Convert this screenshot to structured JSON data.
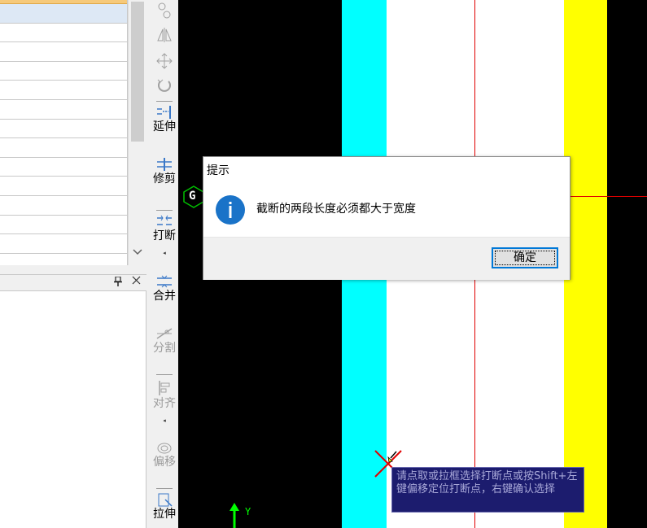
{
  "toolbar": {
    "extend_label": "延伸",
    "trim_label": "修剪",
    "break_label": "打断",
    "merge_label": "合并",
    "split_label": "分割",
    "align_label": "对齐",
    "offset_label": "偏移",
    "stretch_label": "拉伸"
  },
  "canvas": {
    "snap_label": "G",
    "ucs_y_label": "Y",
    "tooltip": "请点取或拉框选择打断点或按Shift+左键偏移定位打断点，右键确认选择"
  },
  "dialog": {
    "title": "提示",
    "message": "截断的两段长度必须都大于宽度",
    "ok_label": "确定"
  },
  "colors": {
    "cyan_band": "#00ffff",
    "yellow_band": "#ffff00",
    "white_band": "#ffffff",
    "red_line": "#e00000",
    "tooltip_bg": "#1c1c6e",
    "info_icon": "#1a73c8",
    "ok_focus": "#0078d7"
  },
  "icons": {
    "scroll_down": "chevron-down-icon",
    "pin": "pin-icon",
    "close": "close-icon",
    "info": "info-icon"
  }
}
